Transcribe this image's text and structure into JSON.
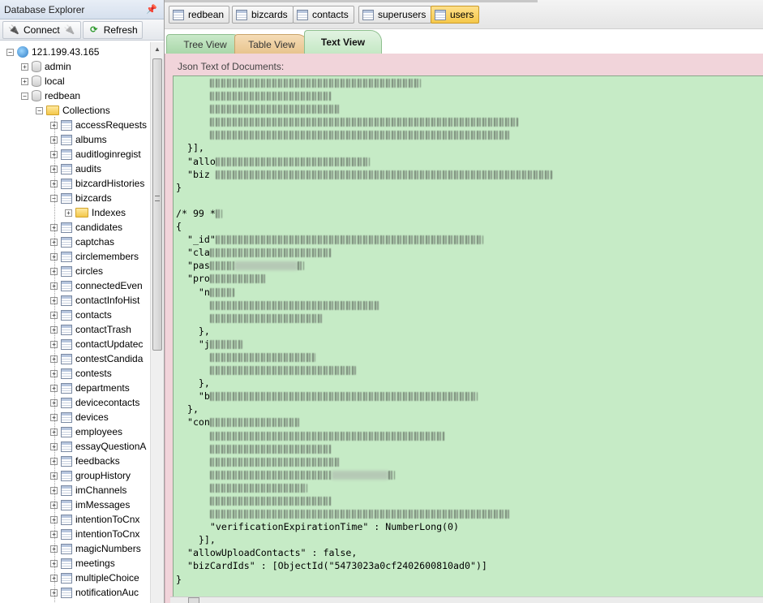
{
  "explorer": {
    "title": "Database Explorer",
    "pin_icon": "pin-icon",
    "toolbar": {
      "connect_label": "Connect",
      "refresh_label": "Refresh"
    },
    "server": "121.199.43.165",
    "databases": [
      "admin",
      "local",
      "redbean"
    ],
    "collections_label": "Collections",
    "indexes_label": "Indexes",
    "collections": [
      "accessRequests",
      "albums",
      "auditloginregist",
      "audits",
      "bizcardHistories",
      "bizcards",
      "candidates",
      "captchas",
      "circlemembers",
      "circles",
      "connectedEven",
      "contactInfoHist",
      "contacts",
      "contactTrash",
      "contactUpdatec",
      "contestCandida",
      "contests",
      "departments",
      "devicecontacts",
      "devices",
      "employees",
      "essayQuestionA",
      "feedbacks",
      "groupHistory",
      "imChannels",
      "imMessages",
      "intentionToCnx",
      "intentionToCnx",
      "magicNumbers",
      "meetings",
      "multipleChoice",
      "notificationAuc"
    ]
  },
  "doc_tabs": [
    {
      "label": "redbean",
      "active": false
    },
    {
      "label": "bizcards",
      "active": false
    },
    {
      "label": "contacts",
      "active": false
    },
    {
      "label": "superusers",
      "active": false
    },
    {
      "label": "users",
      "active": true
    }
  ],
  "view_tabs": {
    "tree": "Tree View",
    "table": "Table View",
    "text": "Text View",
    "active": "text"
  },
  "json_label": "Json Text of Documents:",
  "json_lines": {
    "l5": "  }],",
    "l6": "  \"allo",
    "l7": "  \"biz ",
    "l8": "}",
    "l10": "/* 99 *",
    "l11": "{",
    "l12": "  \"_id\"",
    "l13": "  \"cla",
    "l14": "  \"pas",
    "l15": "  \"pro",
    "l16": "    \"n",
    "l19": "    },",
    "l20": "    \"j",
    "l23": "    },",
    "l24": "    \"b",
    "l25": "  },",
    "l26": "  \"con",
    "l34": "      \"verificationExpirationTime\" : NumberLong(0)",
    "l35": "    }],",
    "l36": "  \"allowUploadContacts\" : false,",
    "l37": "  \"bizCardIds\" : [ObjectId(\"5473023a0cf2402600810ad0\")]",
    "l38": "}"
  }
}
